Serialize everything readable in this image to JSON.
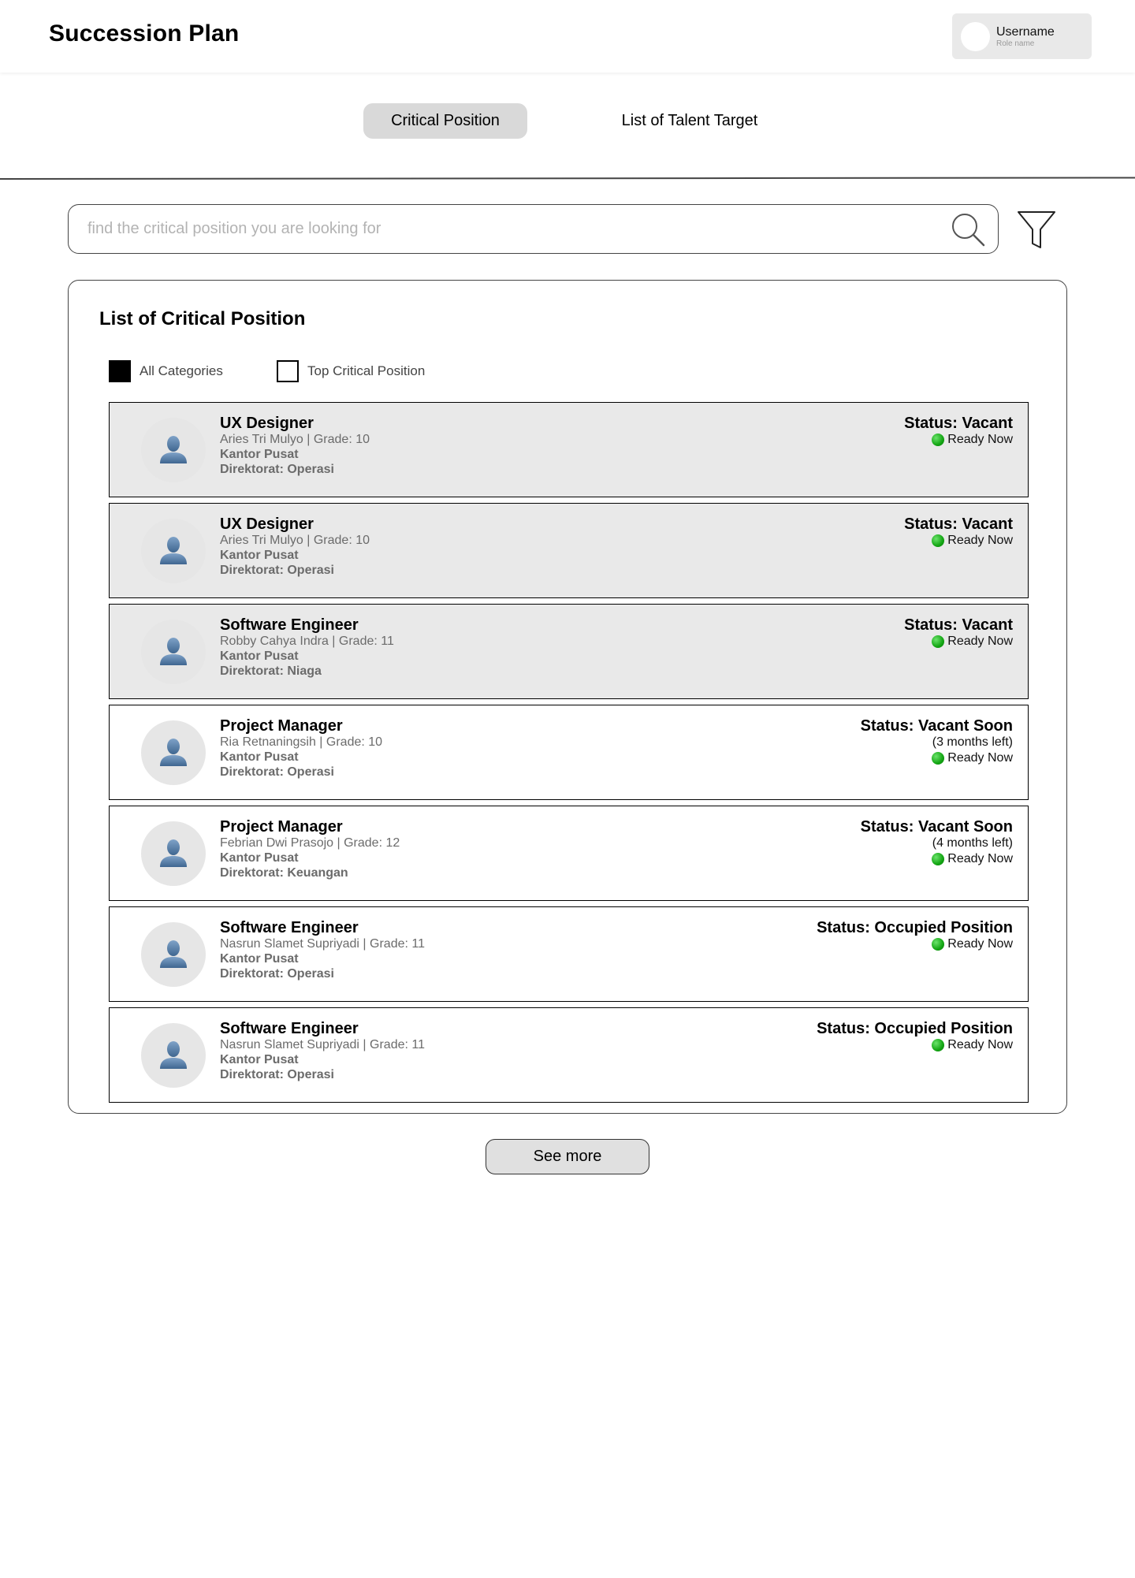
{
  "header": {
    "title": "Succession Plan",
    "user": {
      "name": "Username",
      "role": "Role name"
    }
  },
  "tabs": [
    {
      "label": "Critical Position",
      "active": true
    },
    {
      "label": "List of Talent Target",
      "active": false
    }
  ],
  "search": {
    "placeholder": "find the critical position you are looking for",
    "value": "",
    "icon": "search-icon",
    "filter_icon": "filter-icon"
  },
  "panel": {
    "title": "List of Critical Position",
    "categories": [
      {
        "label": "All Categories",
        "checked": true
      },
      {
        "label": "Top Critical Position",
        "checked": false
      }
    ]
  },
  "positions": [
    {
      "role": "UX Designer",
      "person": "Aries Tri Mulyo | Grade: 10",
      "office": "Kantor Pusat",
      "directorate": "Direktorat: Operasi",
      "status": "Status: Vacant",
      "sub": "",
      "readiness": "Ready Now",
      "shaded": true
    },
    {
      "role": "UX Designer",
      "person": "Aries Tri Mulyo | Grade: 10",
      "office": "Kantor Pusat",
      "directorate": "Direktorat: Operasi",
      "status": "Status: Vacant",
      "sub": "",
      "readiness": "Ready Now",
      "shaded": true
    },
    {
      "role": "Software Engineer",
      "person": "Robby Cahya Indra | Grade: 11",
      "office": "Kantor Pusat",
      "directorate": "Direktorat: Niaga",
      "status": "Status: Vacant",
      "sub": "",
      "readiness": "Ready Now",
      "shaded": true
    },
    {
      "role": "Project Manager",
      "person": "Ria Retnaningsih | Grade: 10",
      "office": "Kantor Pusat",
      "directorate": "Direktorat: Operasi",
      "status": "Status: Vacant Soon",
      "sub": "(3 months left)",
      "readiness": "Ready Now",
      "shaded": false
    },
    {
      "role": "Project Manager",
      "person": "Febrian Dwi Prasojo | Grade: 12",
      "office": "Kantor Pusat",
      "directorate": "Direktorat: Keuangan",
      "status": "Status: Vacant Soon",
      "sub": "(4 months left)",
      "readiness": "Ready Now",
      "shaded": false
    },
    {
      "role": "Software Engineer",
      "person": "Nasrun Slamet Supriyadi | Grade: 11",
      "office": "Kantor Pusat",
      "directorate": "Direktorat: Operasi",
      "status": "Status: Occupied Position",
      "sub": "",
      "readiness": "Ready Now",
      "shaded": false
    },
    {
      "role": "Software Engineer",
      "person": "Nasrun Slamet Supriyadi | Grade: 11",
      "office": "Kantor Pusat",
      "directorate": "Direktorat: Operasi",
      "status": "Status: Occupied Position",
      "sub": "",
      "readiness": "Ready Now",
      "shaded": false
    }
  ],
  "footer": {
    "see_more_label": "See more"
  },
  "colors": {
    "active_tab": "#d9d9d9",
    "shaded_card": "#e9e9e9",
    "ready_indicator": "#13a513"
  }
}
